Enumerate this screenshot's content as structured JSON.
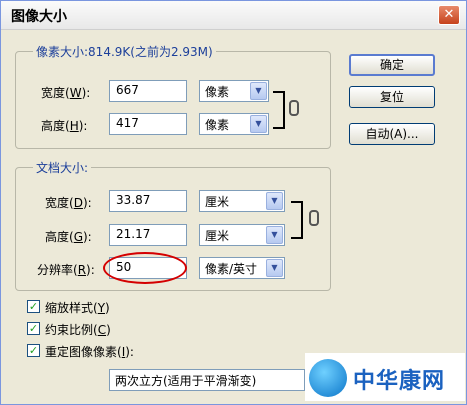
{
  "window": {
    "title": "图像大小",
    "close_glyph": "✕"
  },
  "pixel_dimensions": {
    "legend": "像素大小:814.9K(之前为2.93M)",
    "width": {
      "label_pre": "宽度(",
      "hotkey": "W",
      "label_post": "):",
      "value": "667",
      "unit": "像素"
    },
    "height": {
      "label_pre": "高度(",
      "hotkey": "H",
      "label_post": "):",
      "value": "417",
      "unit": "像素"
    }
  },
  "document_size": {
    "legend": "文档大小:",
    "width": {
      "label_pre": "宽度(",
      "hotkey": "D",
      "label_post": "):",
      "value": "33.87",
      "unit": "厘米"
    },
    "height": {
      "label_pre": "高度(",
      "hotkey": "G",
      "label_post": "):",
      "value": "21.17",
      "unit": "厘米"
    },
    "resolution": {
      "label_pre": "分辨率(",
      "hotkey": "R",
      "label_post": "):",
      "value": "50",
      "unit": "像素/英寸"
    }
  },
  "buttons": {
    "ok": "确定",
    "reset": "复位",
    "auto": "自动(A)..."
  },
  "options": {
    "scale_styles": {
      "label_pre": "缩放样式(",
      "hotkey": "Y",
      "label_post": ")",
      "checked": true
    },
    "constrain": {
      "label_pre": "约束比例(",
      "hotkey": "C",
      "label_post": ")",
      "checked": true
    },
    "resample": {
      "label_pre": "重定图像像素(",
      "hotkey": "I",
      "label_post": "):",
      "checked": true
    }
  },
  "resample_method": "两次立方(适用于平滑渐变)",
  "watermark": {
    "text": "中华康网"
  },
  "colors": {
    "accent": "#1c3f9a",
    "highlight": "#d40000",
    "check": "#21a121"
  }
}
